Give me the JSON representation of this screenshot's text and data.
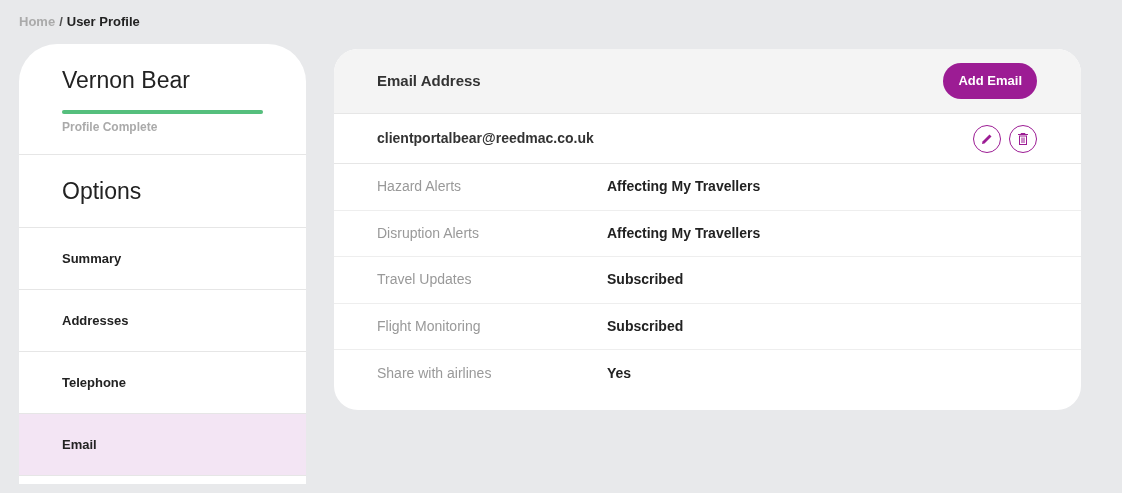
{
  "breadcrumb": {
    "separator": "/",
    "items": [
      {
        "label": "Home"
      },
      {
        "label": "User Profile"
      }
    ]
  },
  "profile": {
    "name": "Vernon Bear",
    "completion": {
      "level": 1,
      "label": "Profile Complete"
    }
  },
  "sidebar": {
    "title": "Options",
    "items": [
      {
        "label": "Summary",
        "selected": false
      },
      {
        "label": "Addresses",
        "selected": false
      },
      {
        "label": "Telephone",
        "selected": false
      },
      {
        "label": "Email",
        "selected": true
      }
    ]
  },
  "email_card": {
    "title": "Email Address",
    "add_button": "Add Email",
    "email": "clientportalbear@reedmac.co.uk",
    "settings": [
      {
        "label": "Hazard Alerts",
        "value": "Affecting My Travellers"
      },
      {
        "label": "Disruption Alerts",
        "value": "Affecting My Travellers"
      },
      {
        "label": "Travel Updates",
        "value": "Subscribed"
      },
      {
        "label": "Flight Monitoring",
        "value": "Subscribed"
      },
      {
        "label": "Share with airlines",
        "value": "Yes"
      }
    ]
  }
}
